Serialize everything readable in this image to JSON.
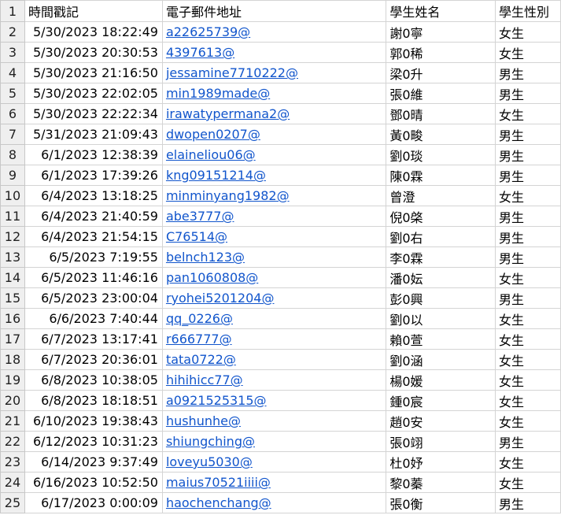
{
  "columns": {
    "timestamp": "時間戳記",
    "email": "電子郵件地址",
    "name": "學生姓名",
    "gender": "學生性別"
  },
  "header_row_number": "1",
  "rows": [
    {
      "n": "2",
      "timestamp": "5/30/2023 18:22:49",
      "email": "a22625739@",
      "name": "謝0寧",
      "gender": "女生"
    },
    {
      "n": "3",
      "timestamp": "5/30/2023 20:30:53",
      "email": "4397613@",
      "name": "郭0稀",
      "gender": "女生"
    },
    {
      "n": "4",
      "timestamp": "5/30/2023 21:16:50",
      "email": "jessamine7710222@",
      "name": "梁0升",
      "gender": "男生"
    },
    {
      "n": "5",
      "timestamp": "5/30/2023 22:02:05",
      "email": "min1989made@",
      "name": "張0維",
      "gender": "男生"
    },
    {
      "n": "6",
      "timestamp": "5/30/2023 22:22:34",
      "email": "irawatypermana2@",
      "name": "鄧0晴",
      "gender": "女生"
    },
    {
      "n": "7",
      "timestamp": "5/31/2023 21:09:43",
      "email": "dwopen0207@",
      "name": "黃0畯",
      "gender": "男生"
    },
    {
      "n": "8",
      "timestamp": "6/1/2023 12:38:39",
      "email": "elaineliou06@",
      "name": "劉0琰",
      "gender": "男生"
    },
    {
      "n": "9",
      "timestamp": "6/1/2023 17:39:26",
      "email": "kng09151214@",
      "name": "陳0霖",
      "gender": "男生"
    },
    {
      "n": "10",
      "timestamp": "6/4/2023 13:18:25",
      "email": "minminyang1982@",
      "name": "曾澄",
      "gender": "女生"
    },
    {
      "n": "11",
      "timestamp": "6/4/2023 21:40:59",
      "email": "abe3777@",
      "name": "倪0棨",
      "gender": "男生"
    },
    {
      "n": "12",
      "timestamp": "6/4/2023 21:54:15",
      "email": "C76514@",
      "name": "劉0右",
      "gender": "男生"
    },
    {
      "n": "13",
      "timestamp": "6/5/2023 7:19:55",
      "email": "belnch123@",
      "name": "李0霖",
      "gender": "男生"
    },
    {
      "n": "14",
      "timestamp": "6/5/2023 11:46:16",
      "email": "pan1060808@",
      "name": "潘0妘",
      "gender": "女生"
    },
    {
      "n": "15",
      "timestamp": "6/5/2023 23:00:04",
      "email": "ryohei5201204@",
      "name": "彭0興",
      "gender": "男生"
    },
    {
      "n": "16",
      "timestamp": "6/6/2023 7:40:44",
      "email": "qq_0226@",
      "name": "劉0以",
      "gender": "女生"
    },
    {
      "n": "17",
      "timestamp": "6/7/2023 13:17:41",
      "email": "r666777@",
      "name": "賴0萱",
      "gender": "女生"
    },
    {
      "n": "18",
      "timestamp": "6/7/2023 20:36:01",
      "email": "tata0722@",
      "name": "劉0涵",
      "gender": "女生"
    },
    {
      "n": "19",
      "timestamp": "6/8/2023 10:38:05",
      "email": "hihihicc77@",
      "name": "楊0媛",
      "gender": "女生"
    },
    {
      "n": "20",
      "timestamp": "6/8/2023 18:18:51",
      "email": "a0921525315@",
      "name": "鍾0宸",
      "gender": "女生"
    },
    {
      "n": "21",
      "timestamp": "6/10/2023 19:38:43",
      "email": "hushunhe@",
      "name": "趙0安",
      "gender": "女生"
    },
    {
      "n": "22",
      "timestamp": "6/12/2023 10:31:23",
      "email": "shiungching@",
      "name": "張0翊",
      "gender": "男生"
    },
    {
      "n": "23",
      "timestamp": "6/14/2023 9:37:49",
      "email": "loveyu5030@",
      "name": "杜0妤",
      "gender": "女生"
    },
    {
      "n": "24",
      "timestamp": "6/16/2023 10:52:50",
      "email": "maius70521iiii@",
      "name": "黎0蓁",
      "gender": "女生"
    },
    {
      "n": "25",
      "timestamp": "6/17/2023 0:00:09",
      "email": "haochenchang@",
      "name": "張0衡",
      "gender": "男生"
    }
  ]
}
